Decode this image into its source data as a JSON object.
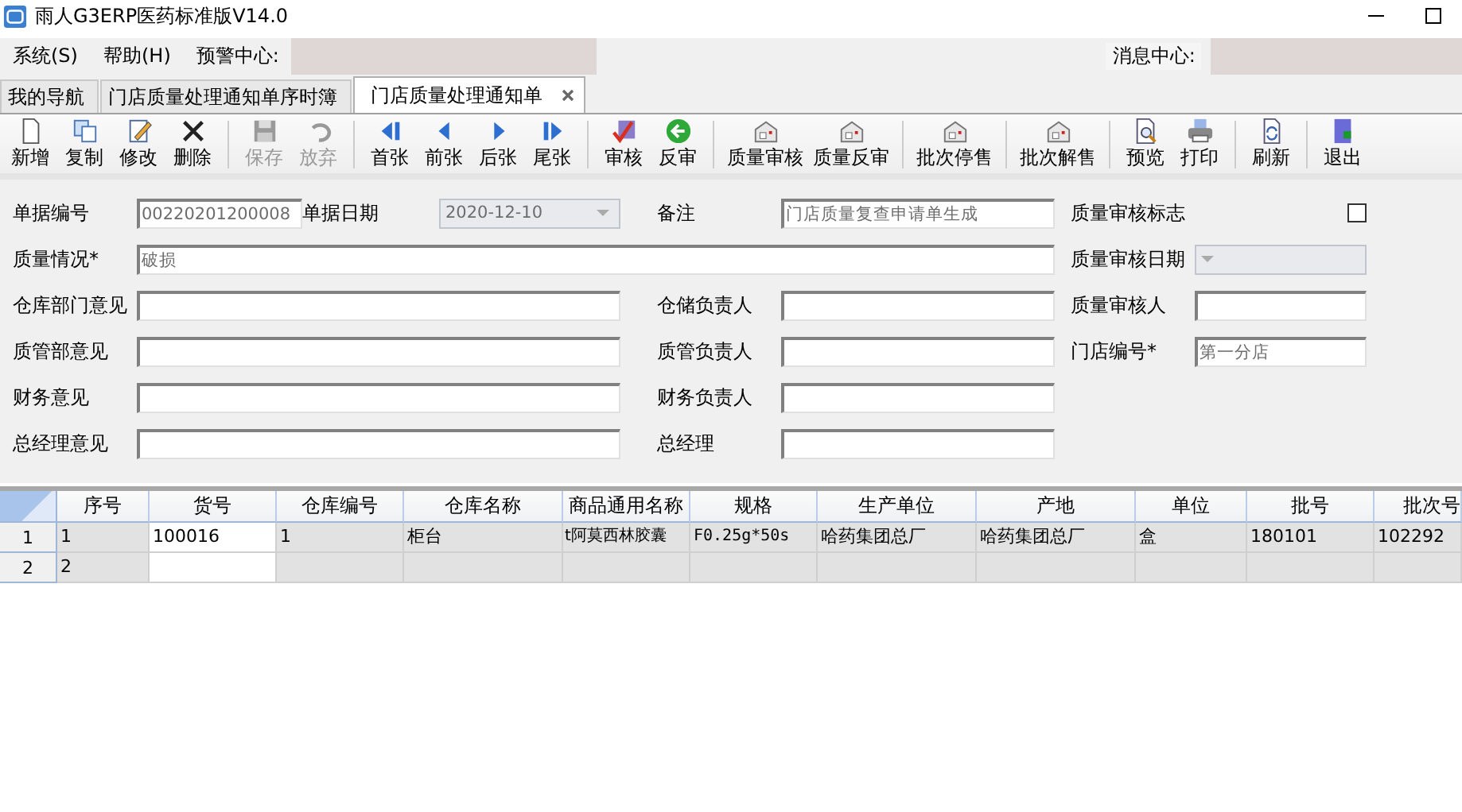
{
  "window": {
    "title": "雨人G3ERP医药标准版V14.0"
  },
  "menu": [
    {
      "label": "系统(S)"
    },
    {
      "label": "帮助(H)"
    }
  ],
  "alert_center": {
    "label": "预警中心:"
  },
  "message_center": {
    "label": "消息中心:"
  },
  "tabs": [
    {
      "label": "我的导航",
      "selected": false,
      "closable": false
    },
    {
      "label": "门店质量处理通知单序时簿",
      "selected": false,
      "closable": false
    },
    {
      "label": "门店质量处理通知单",
      "selected": true,
      "closable": true
    }
  ],
  "toolbar": [
    [
      {
        "label": "新增",
        "disabled": false
      },
      {
        "label": "复制",
        "disabled": false
      },
      {
        "label": "修改",
        "disabled": false
      },
      {
        "label": "删除",
        "disabled": false
      }
    ],
    [
      {
        "label": "保存",
        "disabled": true
      },
      {
        "label": "放弃",
        "disabled": true
      }
    ],
    [
      {
        "label": "首张",
        "disabled": false
      },
      {
        "label": "前张",
        "disabled": false
      },
      {
        "label": "后张",
        "disabled": false
      },
      {
        "label": "尾张",
        "disabled": false
      }
    ],
    [
      {
        "label": "审核",
        "disabled": false
      },
      {
        "label": "反审",
        "disabled": false
      }
    ],
    [
      {
        "label": "质量审核",
        "disabled": false
      },
      {
        "label": "质量反审",
        "disabled": false
      }
    ],
    [
      {
        "label": "批次停售",
        "disabled": false
      }
    ],
    [
      {
        "label": "批次解售",
        "disabled": false
      }
    ],
    [
      {
        "label": "预览",
        "disabled": false
      },
      {
        "label": "打印",
        "disabled": false
      }
    ],
    [
      {
        "label": "刷新",
        "disabled": false
      }
    ],
    [
      {
        "label": "退出",
        "disabled": false
      }
    ]
  ],
  "form": {
    "fields": [
      {
        "label": "单据编号",
        "kind": "text",
        "value": "00220201200008"
      },
      {
        "label": "单据日期",
        "kind": "date",
        "value": "2020-12-10",
        "disabled": true
      },
      {
        "label": "备注",
        "kind": "text",
        "value": "门店质量复查申请单生成"
      },
      {
        "label": "质量审核标志",
        "kind": "checkbox",
        "checked": false
      },
      {
        "label": "质量情况*",
        "kind": "text",
        "value": "破损"
      },
      {
        "label": "质量审核日期",
        "kind": "date",
        "disabled": true
      },
      {
        "label": "仓库部门意见",
        "kind": "text"
      },
      {
        "label": "仓储负责人",
        "kind": "text"
      },
      {
        "label": "质量审核人",
        "kind": "text"
      },
      {
        "label": "质管部意见",
        "kind": "text"
      },
      {
        "label": "质管负责人",
        "kind": "text"
      },
      {
        "label": "门店编号*",
        "kind": "text",
        "value": "第一分店"
      },
      {
        "label": "财务意见",
        "kind": "text"
      },
      {
        "label": "财务负责人",
        "kind": "text"
      },
      {
        "label": "总经理意见",
        "kind": "text"
      },
      {
        "label": "总经理",
        "kind": "text"
      }
    ]
  },
  "table": {
    "columns": [
      {
        "label": "序号",
        "editable": false
      },
      {
        "label": "货号",
        "editable": true
      },
      {
        "label": "仓库编号",
        "editable": false
      },
      {
        "label": "仓库名称",
        "editable": false
      },
      {
        "label": "商品通用名称",
        "editable": false
      },
      {
        "label": "规格",
        "editable": false
      },
      {
        "label": "生产单位",
        "editable": false
      },
      {
        "label": "产地",
        "editable": false
      },
      {
        "label": "单位",
        "editable": false
      },
      {
        "label": "批号",
        "editable": false
      },
      {
        "label": "批次号",
        "editable": false
      }
    ],
    "rows": [
      {
        "number": "1",
        "cells": [
          "1",
          "100016",
          "1",
          "柜台",
          "t阿莫西林胶囊",
          "F0.25g*50s",
          "哈药集团总厂",
          "哈药集团总厂",
          "盒",
          "180101",
          "102292"
        ]
      },
      {
        "number": "2",
        "cells": [
          "2"
        ]
      }
    ]
  }
}
